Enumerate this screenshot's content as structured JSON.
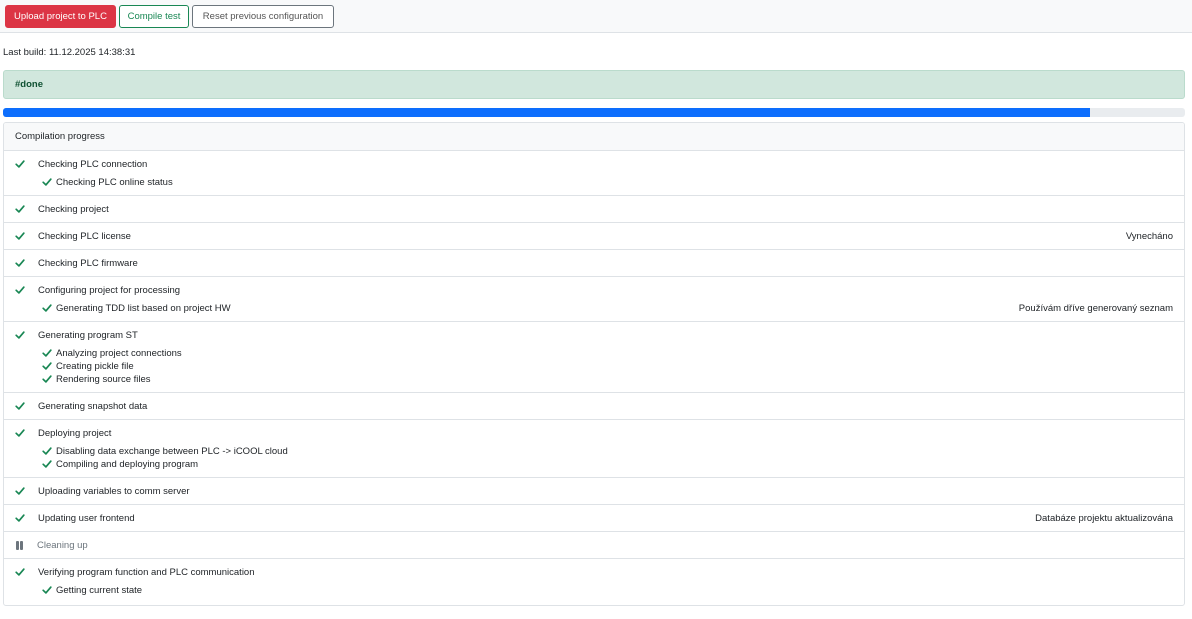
{
  "toolbar": {
    "upload_label": "Upload project to PLC",
    "compile_label": "Compile test",
    "reset_label": "Reset previous configuration"
  },
  "last_build": "Last build: 11.12.2025 14:38:31",
  "alert": {
    "text": "#done",
    "color": "#d1e7dd"
  },
  "progress": {
    "value_percent": 92,
    "color": "#0d6efd"
  },
  "panel": {
    "title": "Compilation progress"
  },
  "steps": [
    {
      "label": "Checking PLC connection",
      "status": "done",
      "note": "",
      "substeps": [
        {
          "label": "Checking PLC online status"
        }
      ]
    },
    {
      "label": "Checking project",
      "status": "done",
      "note": "",
      "substeps": []
    },
    {
      "label": "Checking PLC license",
      "status": "done",
      "note": "Vynecháno",
      "substeps": []
    },
    {
      "label": "Checking PLC firmware",
      "status": "done",
      "note": "",
      "substeps": []
    },
    {
      "label": "Configuring project for processing",
      "status": "done",
      "note": "",
      "substeps": [
        {
          "label": "Generating TDD list based on project HW",
          "note": "Používám dříve generovaný seznam"
        }
      ]
    },
    {
      "label": "Generating program ST",
      "status": "done",
      "note": "",
      "substeps": [
        {
          "label": "Analyzing project connections"
        },
        {
          "label": "Creating pickle file"
        },
        {
          "label": "Rendering source files"
        }
      ]
    },
    {
      "label": "Generating snapshot data",
      "status": "done",
      "note": "",
      "substeps": []
    },
    {
      "label": "Deploying project",
      "status": "done",
      "note": "",
      "substeps": [
        {
          "label": "Disabling data exchange between PLC -> iCOOL cloud"
        },
        {
          "label": "Compiling and deploying program"
        }
      ]
    },
    {
      "label": "Uploading variables to comm server",
      "status": "done",
      "note": "",
      "substeps": []
    },
    {
      "label": "Updating user frontend",
      "status": "done",
      "note": "Databáze projektu aktualizována",
      "substeps": []
    },
    {
      "label": "Cleaning up",
      "status": "paused",
      "note": "",
      "substeps": []
    },
    {
      "label": "Verifying program function and PLC communication",
      "status": "done",
      "note": "",
      "substeps": [
        {
          "label": "Getting current state"
        }
      ]
    }
  ],
  "icons": {
    "done": "check-icon",
    "paused": "pause-icon",
    "check_color": "#198754"
  }
}
